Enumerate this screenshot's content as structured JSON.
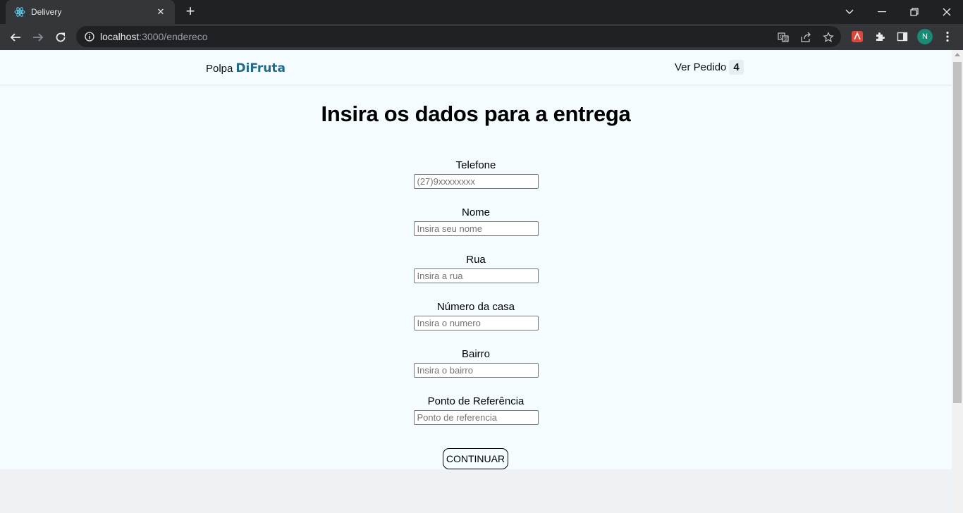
{
  "browser": {
    "tab_title": "Delivery",
    "url_host": "localhost",
    "url_rest": ":3000/endereco",
    "profile_initial": "N"
  },
  "header": {
    "brand_prefix": "Polpa",
    "brand_name": "DiFruta",
    "order_label": "Ver Pedido",
    "order_count": "4"
  },
  "form": {
    "title": "Insira os dados para a entrega",
    "fields": [
      {
        "label": "Telefone",
        "placeholder": "(27)9xxxxxxxx"
      },
      {
        "label": "Nome",
        "placeholder": "Insira seu nome"
      },
      {
        "label": "Rua",
        "placeholder": "Insira a rua"
      },
      {
        "label": "Número da casa",
        "placeholder": "Insira o numero"
      },
      {
        "label": "Bairro",
        "placeholder": "Insira o bairro"
      },
      {
        "label": "Ponto de Referência",
        "placeholder": "Ponto de referencia"
      }
    ],
    "submit_label": "CONTINUAR"
  },
  "colors": {
    "page_bg": "#f4fcff",
    "brand_accent": "#1f6a86",
    "chrome_dark": "#202124",
    "chrome_mid": "#35363a"
  }
}
